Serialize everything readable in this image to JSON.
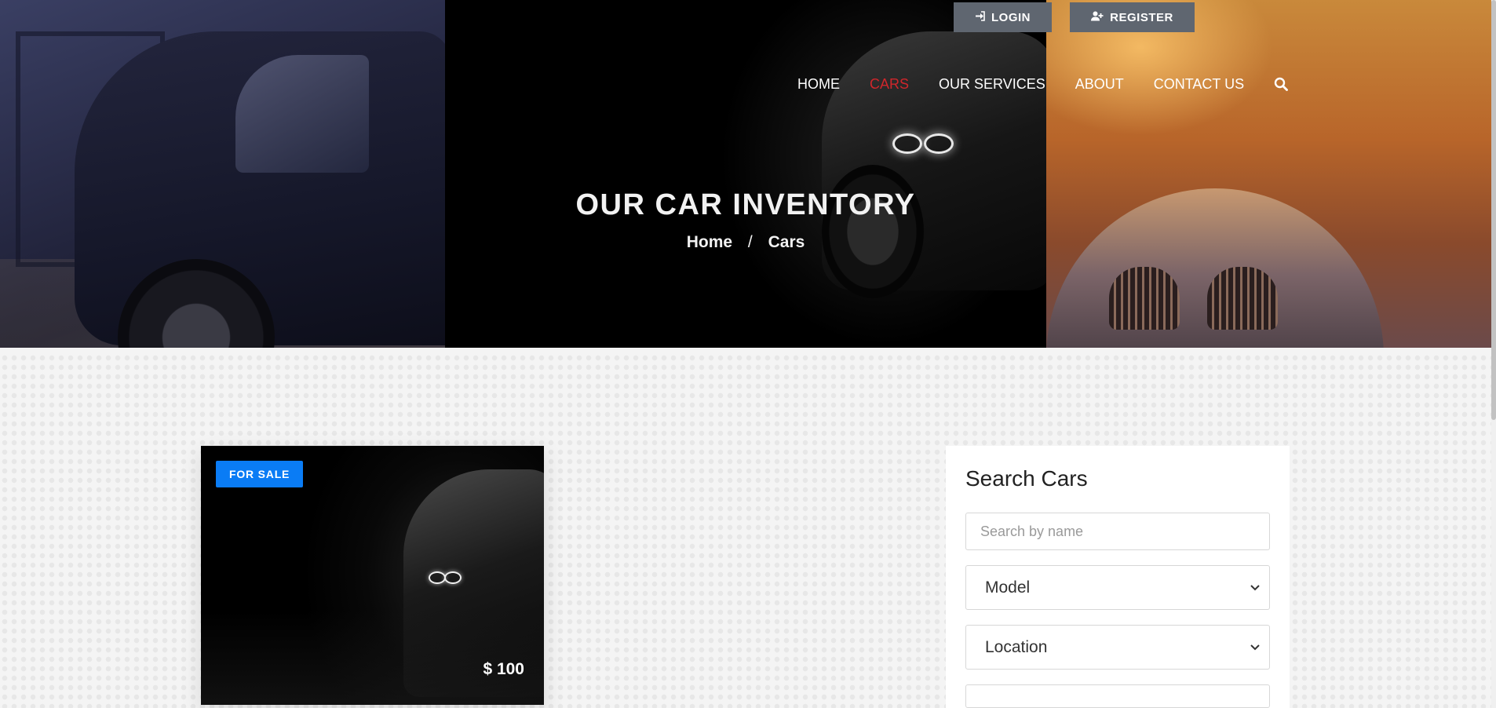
{
  "header": {
    "login_label": "LOGIN",
    "register_label": "REGISTER",
    "nav": [
      {
        "label": "HOME",
        "active": false
      },
      {
        "label": "CARS",
        "active": true
      },
      {
        "label": "OUR SERVICES",
        "active": false
      },
      {
        "label": "ABOUT",
        "active": false
      },
      {
        "label": "CONTACT US",
        "active": false
      }
    ]
  },
  "hero": {
    "title": "OUR CAR INVENTORY",
    "breadcrumb": {
      "home": "Home",
      "separator": "/",
      "current": "Cars"
    }
  },
  "listing": {
    "badge": "FOR SALE",
    "price": "$ 100"
  },
  "search": {
    "title": "Search Cars",
    "name_placeholder": "Search by name",
    "model_selected": "Model",
    "location_selected": "Location"
  },
  "colors": {
    "accent_blue": "#0a7cf5",
    "active_nav_red": "#d0262b",
    "top_button_gray": "#5f6670"
  },
  "icons": [
    "sign-in-icon",
    "user-plus-icon",
    "search-icon",
    "chevron-down-icon"
  ]
}
